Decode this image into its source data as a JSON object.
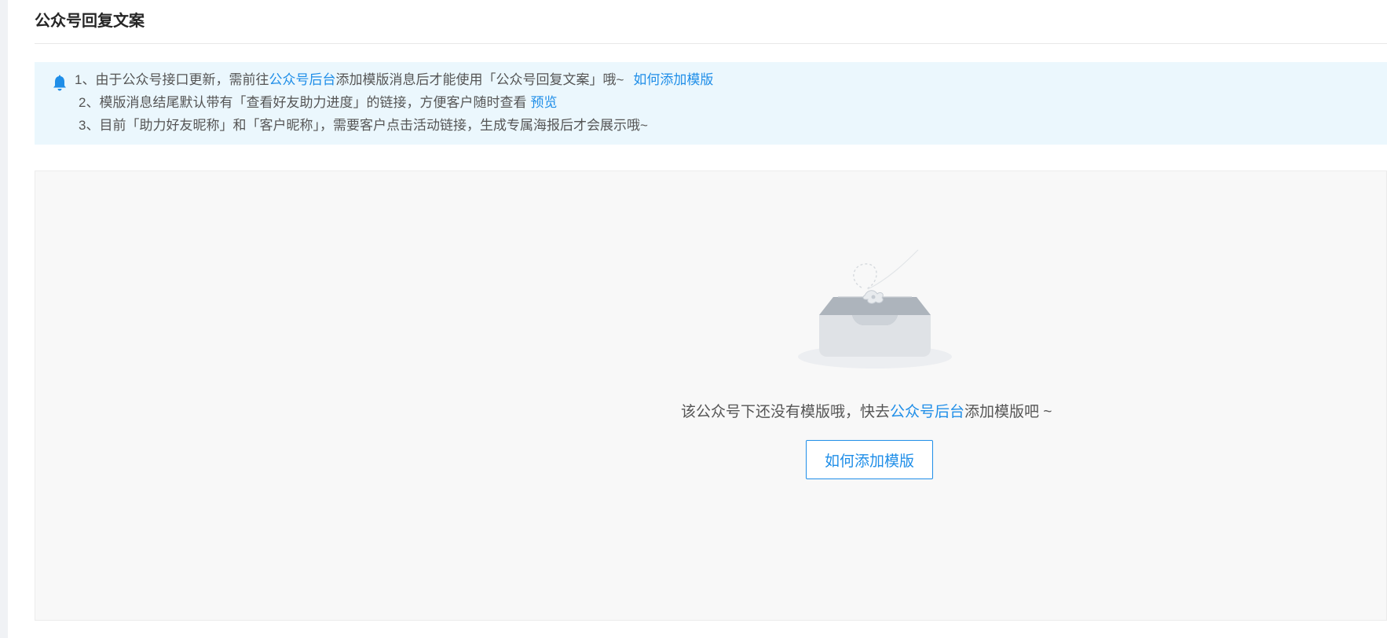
{
  "page": {
    "title": "公众号回复文案"
  },
  "notice": {
    "icon": "bell-icon",
    "line1": {
      "prefix": "1、由于公众号接口更新，需前往",
      "link1": "公众号后台",
      "middle": "添加模版消息后才能使用「公众号回复文案」哦~",
      "link2": "如何添加模版"
    },
    "line2": {
      "prefix": "2、模版消息结尾默认带有「查看好友助力进度」的链接，方便客户随时查看",
      "link": "预览"
    },
    "line3": {
      "text": "3、目前「助力好友昵称」和「客户昵称」，需要客户点击活动链接，生成专属海报后才会展示哦~"
    }
  },
  "empty_state": {
    "illustration": "empty-inbox-illustration",
    "text_prefix": "该公众号下还没有模版哦，快去",
    "text_link": "公众号后台",
    "text_suffix": "添加模版吧 ~",
    "button_label": "如何添加模版"
  },
  "colors": {
    "accent": "#1f8ee8",
    "notice_bg": "#ebf7fd",
    "empty_bg": "#f8f8f8"
  }
}
